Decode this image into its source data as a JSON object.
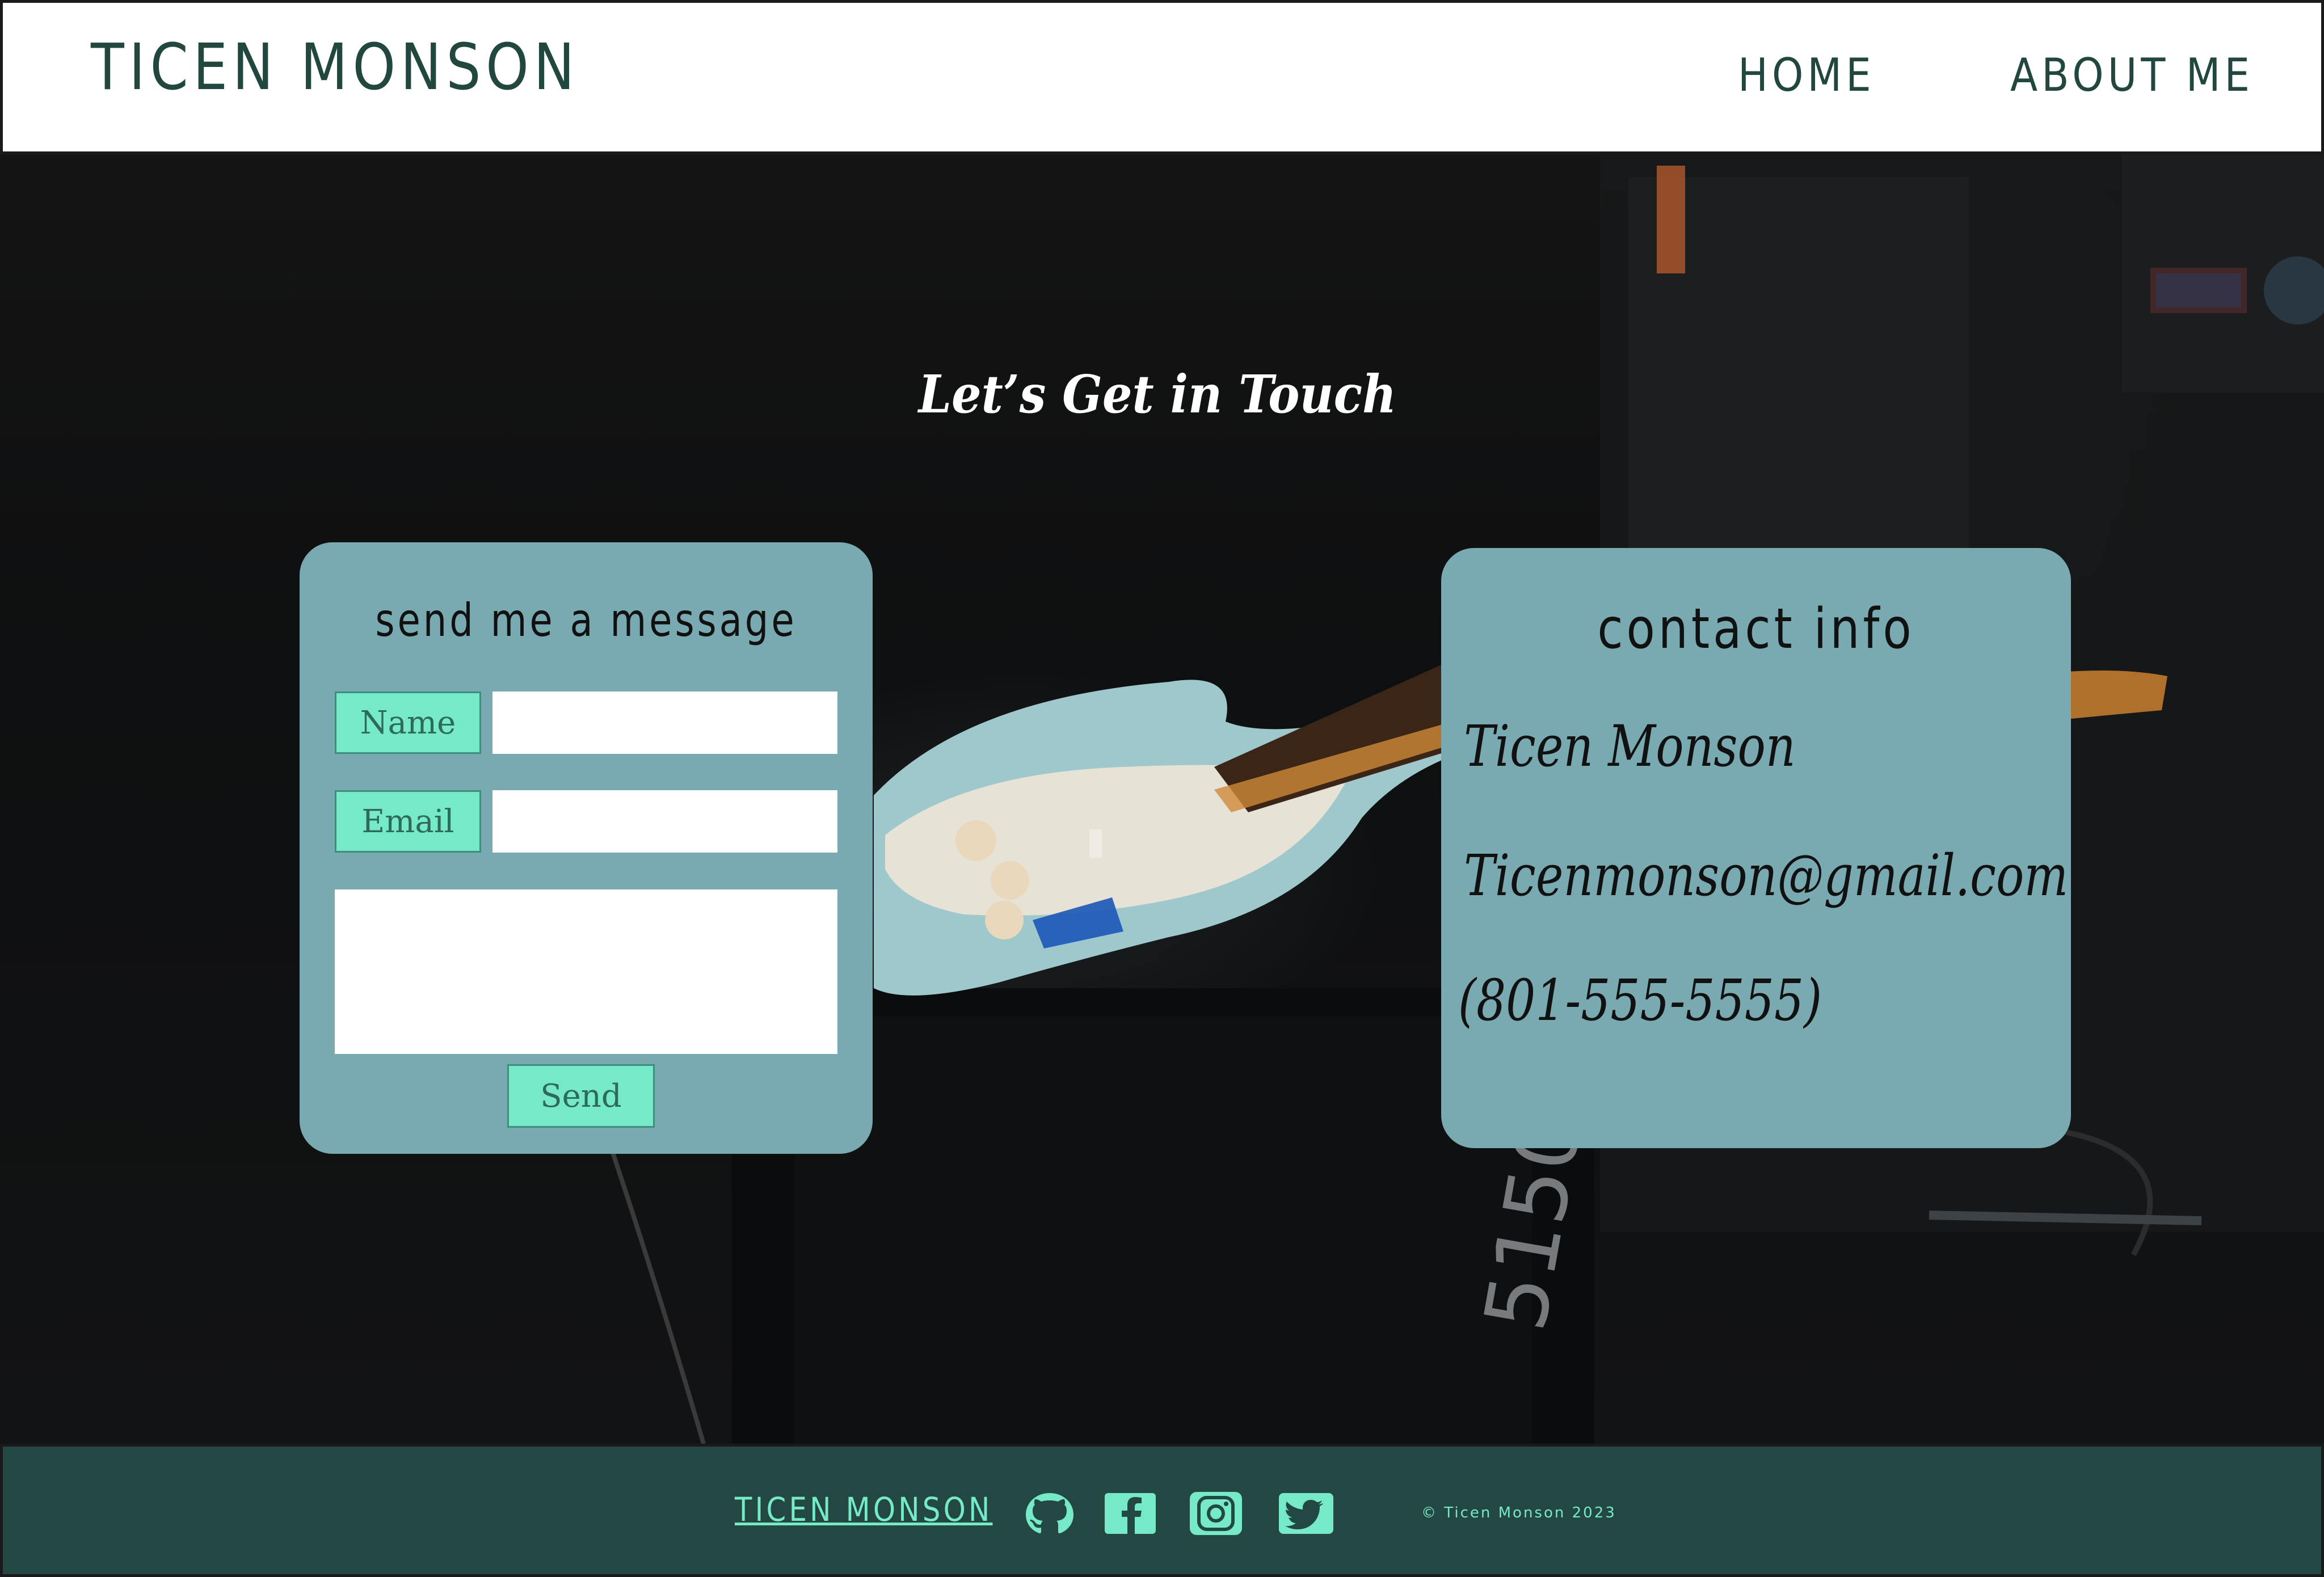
{
  "header": {
    "brand": "Ticen Monson",
    "nav": [
      {
        "label": "Home"
      },
      {
        "label": "About Me"
      }
    ]
  },
  "hero": {
    "title": "Let’s Get in Touch"
  },
  "message_form": {
    "heading": "send me a message",
    "name_label": "Name",
    "name_value": "",
    "email_label": "Email",
    "email_value": "",
    "message_value": "",
    "send_label": "Send"
  },
  "contact_info": {
    "heading": "contact info",
    "name": "Ticen Monson",
    "email": "Ticenmonson@gmail.com",
    "phone": "(801-555-5555)"
  },
  "footer": {
    "brand": "Ticen Monson",
    "social_icons": [
      "github-icon",
      "facebook-icon",
      "instagram-icon",
      "twitter-icon"
    ],
    "copyright": "© Ticen Monson 2023"
  },
  "colors": {
    "header_bg": "#ffffff",
    "brand_text": "#22473f",
    "card_bg": "#79aab1",
    "accent_mint": "#75e9c8",
    "footer_bg": "#234843"
  }
}
